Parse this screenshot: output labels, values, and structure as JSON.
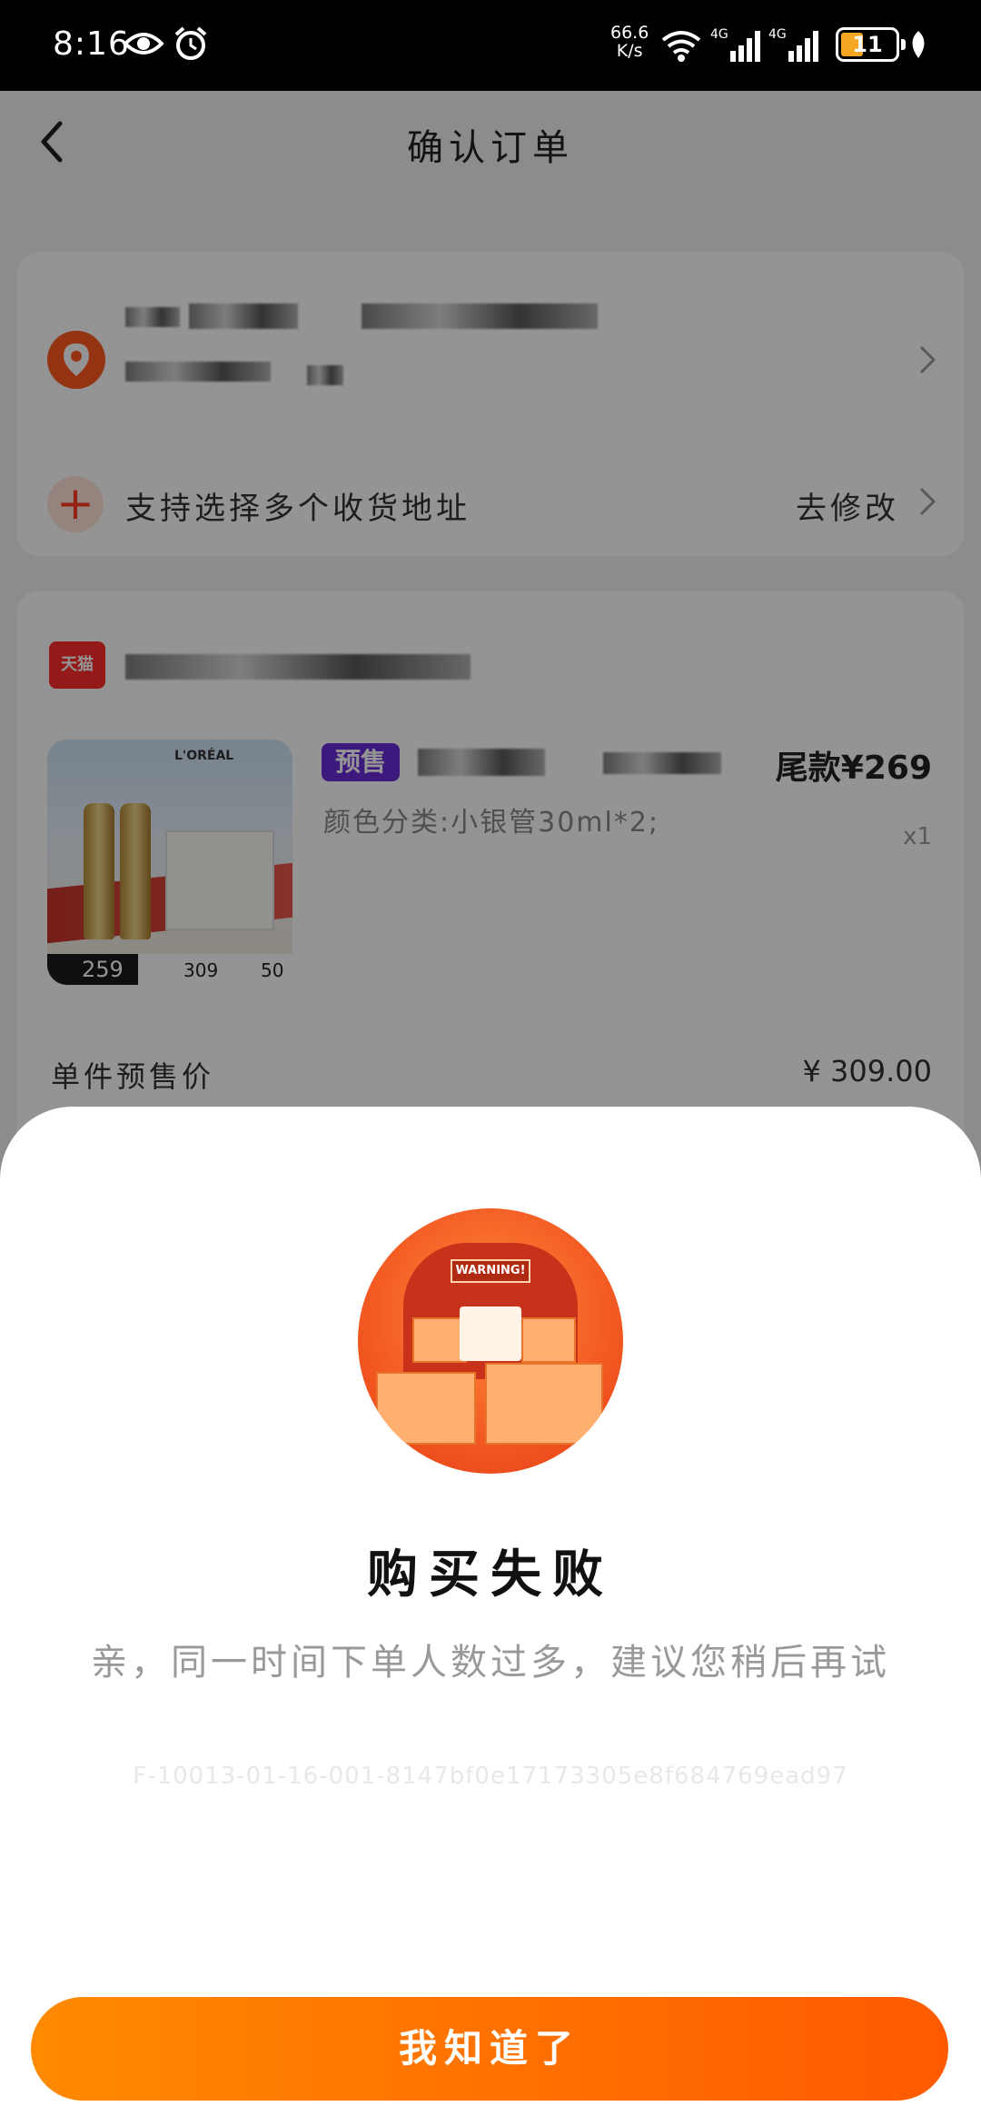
{
  "status_bar": {
    "time": "8:16",
    "net_speed_value": "66.6",
    "net_speed_unit": "K/s",
    "sig1_label": "4G",
    "sig2_label": "4G",
    "battery_level": "11"
  },
  "nav": {
    "title": "确认订单"
  },
  "address": {
    "multi_address_label": "支持选择多个收货地址",
    "modify_label": "去修改"
  },
  "goods": {
    "store_icon_text": "天猫",
    "presale_badge": "预售",
    "balance_price": "尾款¥269",
    "spec": "颜色分类:小银管30ml*2;",
    "quantity": "x1",
    "thumb_brand": "L'ORÉAL",
    "thumb_price_main": "259",
    "thumb_price_mid": "309",
    "thumb_price_right": "50",
    "unit_price_label": "单件预售价",
    "unit_price_value": "¥ 309.00"
  },
  "dialog": {
    "warning_text": "WARNING!",
    "title": "购买失败",
    "message": "亲，同一时间下单人数过多，建议您稍后再试",
    "error_code": "F-10013-01-16-001-8147bf0e17173305e8f684769ead97",
    "confirm_button": "我知道了"
  },
  "colors": {
    "accent_orange": "#ff6a00",
    "presale_purple": "#6a2bd9",
    "location_orange": "#ff5a1f"
  }
}
